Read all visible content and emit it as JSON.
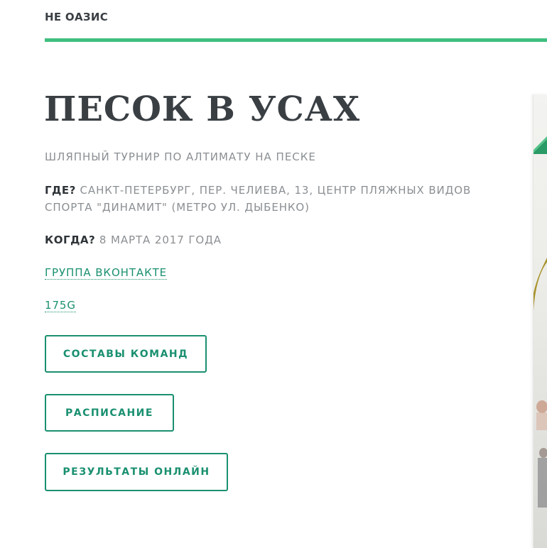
{
  "header": {
    "title": "НЕ ОАЗИС"
  },
  "hero": {
    "title": "ПЕСОК В УСАХ",
    "subtitle": "ШЛЯПНЫЙ ТУРНИР ПО АЛТИМАТУ НА ПЕСКЕ",
    "where_label": "ГДЕ?",
    "where_value": "САНКТ-ПЕТЕРБУРГ, ПЕР. ЧЕЛИЕВА, 13, ЦЕНТР ПЛЯЖНЫХ ВИДОВ СПОРТА \"ДИНАМИТ\" (МЕТРО УЛ. ДЫБЕНКО)",
    "when_label": "КОГДА?",
    "when_value": "8 МАРТА 2017 ГОДА"
  },
  "links": {
    "vk_group": "ГРУППА ВКОНТАКТЕ",
    "g175": "175G"
  },
  "buttons": {
    "teams": "СОСТАВЫ КОМАНД",
    "schedule": "РАСПИСАНИЕ",
    "results": "РЕЗУЛЬТАТЫ ОНЛАЙН"
  },
  "colors": {
    "accent_green": "#3fbf7f",
    "link_teal": "#1a9070",
    "text_dark": "#3a3f44",
    "text_muted": "#8b8f93"
  }
}
